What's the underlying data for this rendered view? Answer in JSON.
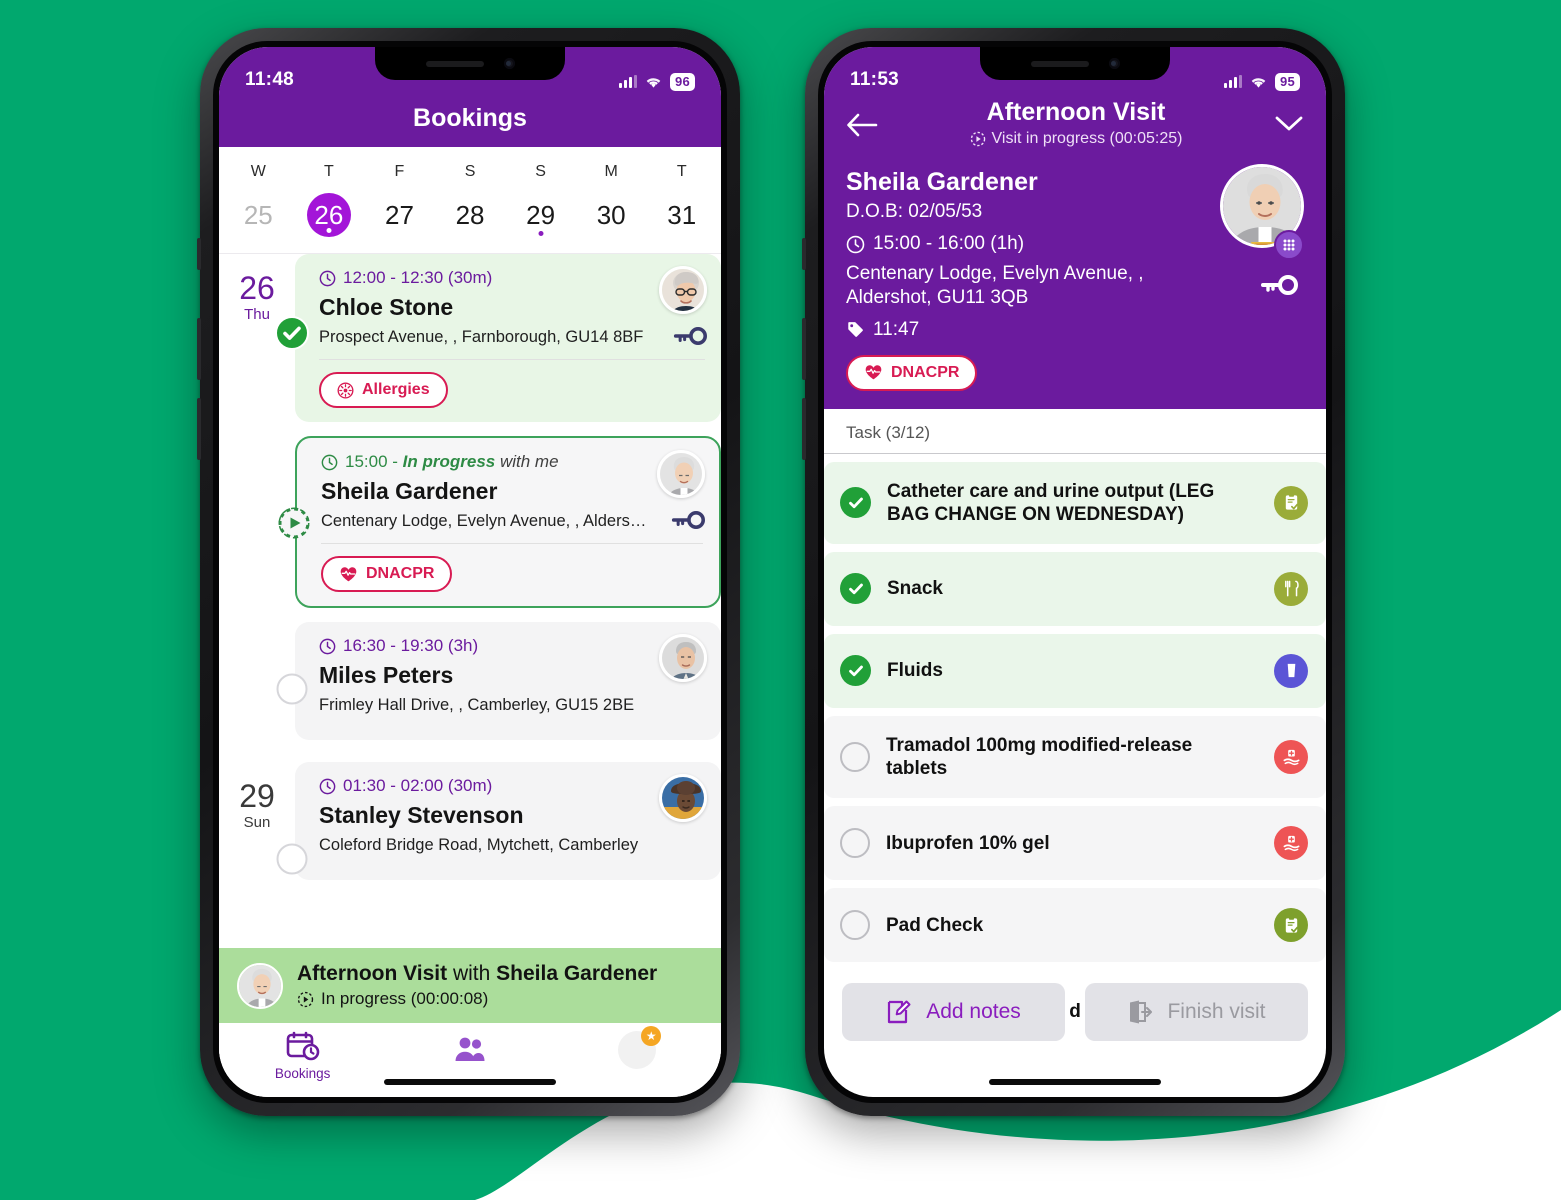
{
  "theme": {
    "brand_purple": "#6B1B9E",
    "accent_purple": "#A315D8",
    "background_green": "#01A86E",
    "alert_crimson": "#D81B53",
    "success_green": "#21A038",
    "ongoing_green": "#ABDD9B"
  },
  "phone1": {
    "status_bar": {
      "time": "11:48",
      "battery": "96",
      "signal_icon": "cellular-bars-icon",
      "wifi_icon": "wifi-icon"
    },
    "header": {
      "title": "Bookings"
    },
    "week_strip": {
      "days": [
        {
          "dow": "W",
          "num": "25",
          "selected": false,
          "dim": true,
          "has_event": false
        },
        {
          "dow": "T",
          "num": "26",
          "selected": true,
          "dim": false,
          "has_event": true
        },
        {
          "dow": "F",
          "num": "27",
          "selected": false,
          "dim": false,
          "has_event": false
        },
        {
          "dow": "S",
          "num": "28",
          "selected": false,
          "dim": false,
          "has_event": false
        },
        {
          "dow": "S",
          "num": "29",
          "selected": false,
          "dim": false,
          "has_event": true
        },
        {
          "dow": "M",
          "num": "30",
          "selected": false,
          "dim": false,
          "has_event": false
        },
        {
          "dow": "T",
          "num": "31",
          "selected": false,
          "dim": false,
          "has_event": false
        }
      ]
    },
    "day_groups": [
      {
        "day_num": "26",
        "day_name": "Thu",
        "bookings": [
          {
            "time": "12:00 - 12:30 (30m)",
            "name": "Chloe Stone",
            "address": "Prospect Avenue, , Farnborough, GU14 8BF",
            "state": "done",
            "badge": "Allergies",
            "badge_icon": "allergy-icon",
            "has_key": true,
            "avatar": "avatar-chloe-stone"
          },
          {
            "time_prefix": "15:00 - ",
            "time_status": "In progress",
            "time_suffix": " with me",
            "name": "Sheila Gardener",
            "address": "Centenary Lodge, Evelyn Avenue, , Alders…",
            "state": "in-progress",
            "badge": "DNACPR",
            "badge_icon": "heart-pulse-icon",
            "has_key": true,
            "avatar": "avatar-sheila-gardener"
          },
          {
            "time": "16:30 - 19:30 (3h)",
            "name": "Miles Peters",
            "address": "Frimley Hall Drive, , Camberley, GU15 2BE",
            "state": "pending",
            "badge": null,
            "has_key": false,
            "avatar": "avatar-miles-peters"
          }
        ]
      },
      {
        "day_num": "29",
        "day_name": "Sun",
        "bookings": [
          {
            "time": "01:30 - 02:00 (30m)",
            "name": "Stanley Stevenson",
            "address": "Coleford Bridge Road, Mytchett, Camberley",
            "state": "pending",
            "badge": null,
            "has_key": false,
            "avatar": "avatar-stanley-stevenson"
          }
        ]
      }
    ],
    "ongoing_bar": {
      "title_prefix": "Afternoon Visit",
      "title_mid": " with ",
      "title_client": "Sheila Gardener",
      "status": "In progress (00:00:08)",
      "status_icon": "play-timer-icon",
      "avatar": "avatar-sheila-gardener"
    },
    "tab_bar": {
      "tabs": [
        {
          "label": "Bookings",
          "icon": "calendar-clock-icon",
          "active": true
        },
        {
          "label": "",
          "icon": "people-icon",
          "active": false
        },
        {
          "label": "",
          "icon": "profile-avatar-icon",
          "active": false,
          "badge_icon": "star-badge-icon"
        }
      ]
    }
  },
  "phone2": {
    "status_bar": {
      "time": "11:53",
      "battery": "95",
      "signal_icon": "cellular-bars-icon",
      "wifi_icon": "wifi-icon"
    },
    "nav": {
      "back_icon": "arrow-left-icon",
      "title": "Afternoon Visit",
      "subtitle": "Visit in progress (00:05:25)",
      "subtitle_icon": "play-timer-icon",
      "collapse_icon": "chevron-down-icon"
    },
    "client": {
      "name": "Sheila Gardener",
      "dob": "D.O.B: 02/05/53",
      "time": "15:00 - 16:00 (1h)",
      "time_icon": "clock-icon",
      "address": "Centenary Lodge, Evelyn Avenue, , Aldershot, GU11 3QB",
      "tag": "11:47",
      "tag_icon": "tag-icon",
      "badge": "DNACPR",
      "badge_icon": "heart-pulse-icon",
      "avatar": "avatar-sheila-gardener",
      "grid_icon": "keypad-grid-icon",
      "key_icon": "key-icon"
    },
    "tasks": {
      "header": "Task (3/12)",
      "items": [
        {
          "label": "Catheter care and urine output (LEG BAG CHANGE ON WEDNESDAY)",
          "checked": true,
          "icon": "clipboard-check-icon",
          "icon_color": "#9AAC39"
        },
        {
          "label": "Snack",
          "checked": true,
          "icon": "cutlery-icon",
          "icon_color": "#9AAC39"
        },
        {
          "label": "Fluids",
          "checked": true,
          "icon": "drink-glass-icon",
          "icon_color": "#5B55D6"
        },
        {
          "label": "Tramadol 100mg modified-release tablets",
          "checked": false,
          "icon": "medication-hand-icon",
          "icon_color": "#EE5455"
        },
        {
          "label": "Ibuprofen 10% gel",
          "checked": false,
          "icon": "medication-hand-icon",
          "icon_color": "#EE5455"
        },
        {
          "label": "Pad Check",
          "checked": false,
          "icon": "clipboard-check-icon",
          "icon_color": "#7EA02C"
        }
      ]
    },
    "actions": {
      "add_notes": "Add notes",
      "add_notes_icon": "edit-note-icon",
      "divider_text": "d",
      "finish_visit": "Finish visit",
      "finish_visit_icon": "exit-door-icon"
    }
  }
}
